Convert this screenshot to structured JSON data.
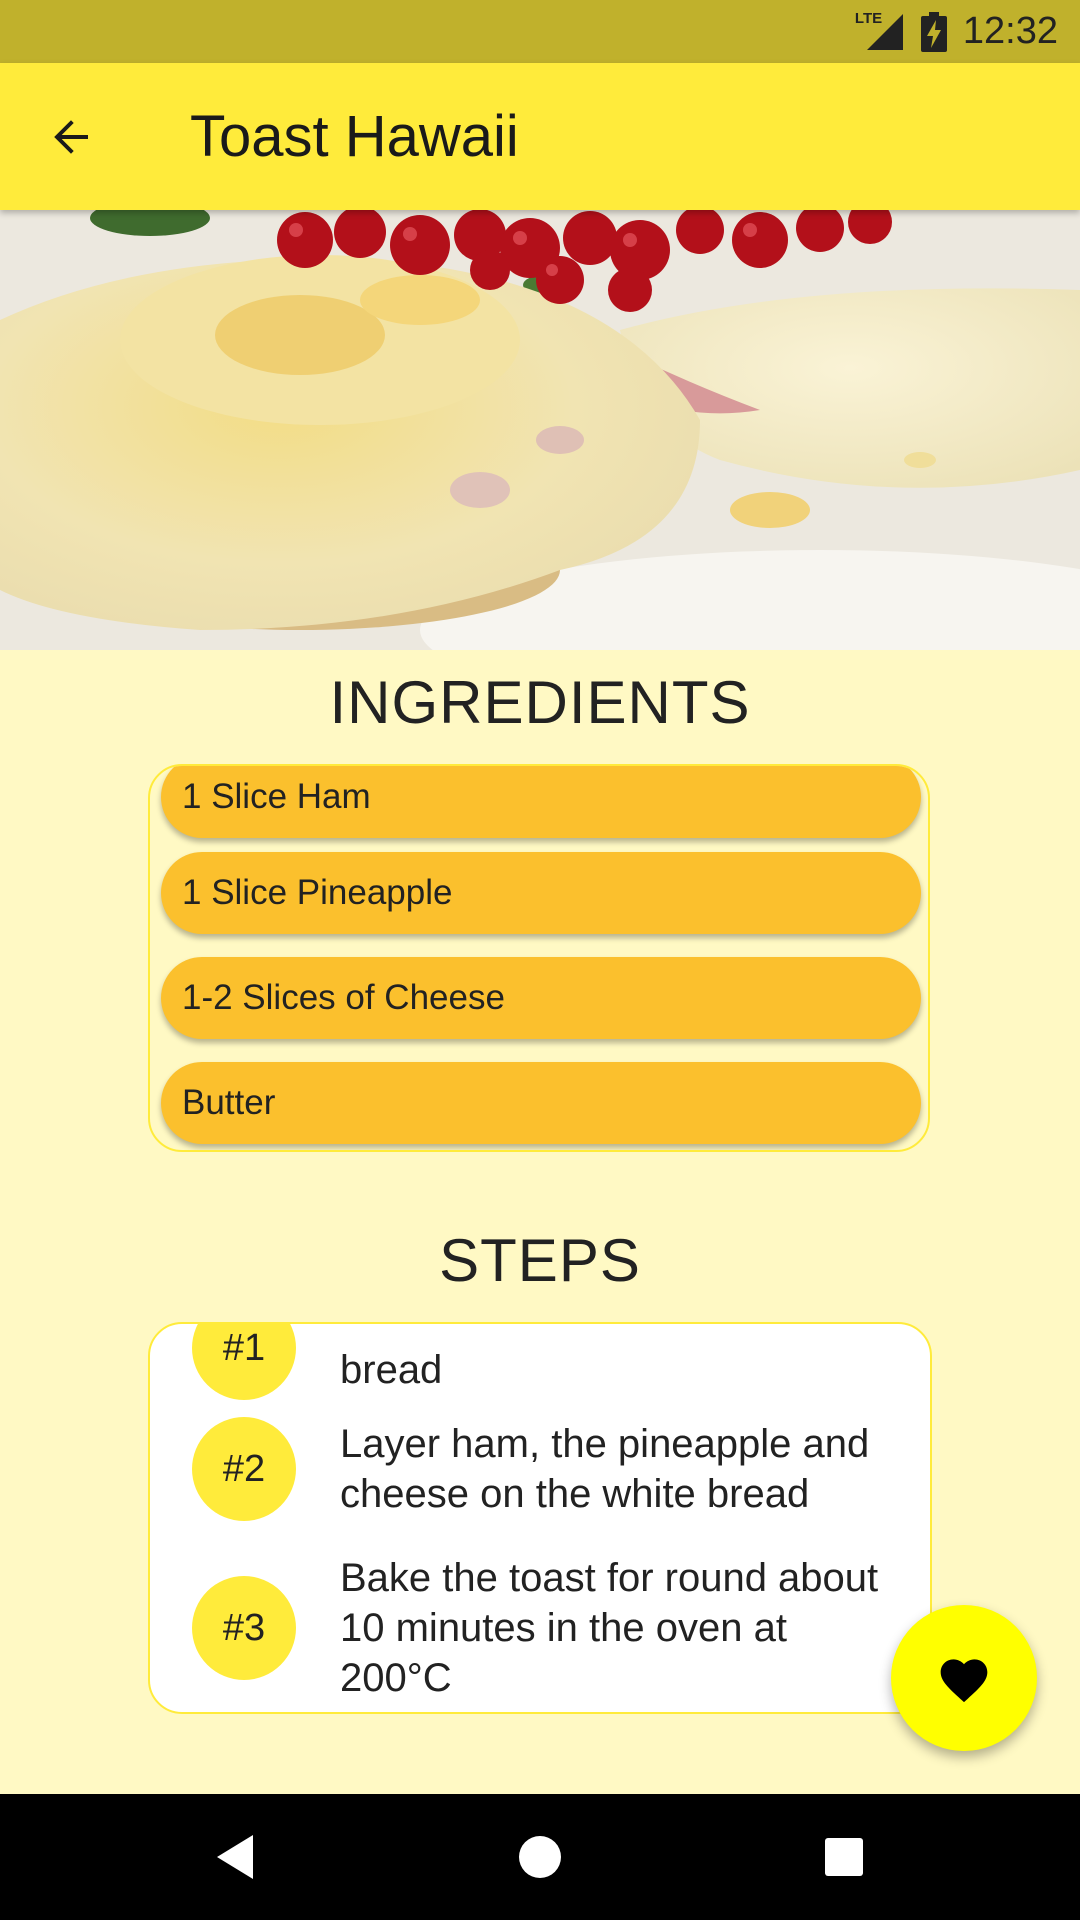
{
  "status_bar": {
    "network_label": "LTE",
    "time": "12:32",
    "icons": [
      "lte-signal-icon",
      "battery-charging-icon"
    ]
  },
  "app_bar": {
    "title": "Toast Hawaii",
    "back_icon": "arrow-back-icon"
  },
  "hero_image": {
    "subject": "photo"
  },
  "ingredients": {
    "heading": "INGREDIENTS",
    "items": [
      "1 Slice Ham",
      "1 Slice Pineapple",
      "1-2 Slices of Cheese",
      "Butter"
    ]
  },
  "steps": {
    "heading": "STEPS",
    "items": [
      {
        "badge": "#1",
        "text": "bread"
      },
      {
        "badge": "#2",
        "text": "Layer ham, the pineapple and cheese on the white bread"
      },
      {
        "badge": "#3",
        "text": "Bake the toast for round about 10 minutes in the oven at 200°C"
      }
    ]
  },
  "fab": {
    "icon": "heart-icon"
  },
  "nav_bar": {
    "icons": [
      "back-triangle-icon",
      "home-circle-icon",
      "recents-square-icon"
    ]
  },
  "colors": {
    "status_bar": "#C0B12C",
    "app_bar": "#FFEB3B",
    "background": "#FFF9C4",
    "ingredient_pill": "#FBC02D",
    "fab": "#FFFF00"
  }
}
